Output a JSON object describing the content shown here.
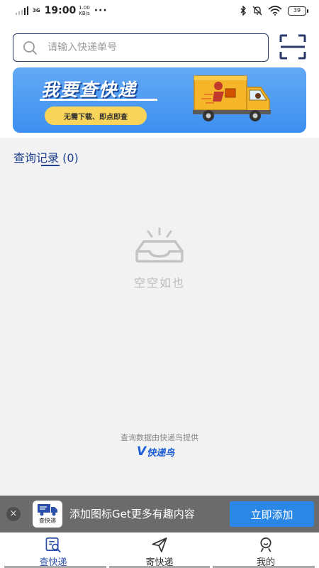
{
  "status_bar": {
    "network": "3G",
    "time": "19:00",
    "speed_value": "1.00",
    "speed_unit": "KB/s",
    "more": "···",
    "battery": "39"
  },
  "search": {
    "placeholder": "请输入快递单号",
    "icon": "search-icon",
    "scan_icon": "scan-icon"
  },
  "banner": {
    "title": "我要查快递",
    "pill": "无需下载、即点即查",
    "colors": {
      "background": "#4a9af2",
      "pill": "#f9d45a",
      "truck": "#f5b62a"
    }
  },
  "history": {
    "title": "查询记录 (0)",
    "empty_text": "空空如也"
  },
  "provider": {
    "text": "查询数据由快递鸟提供",
    "logo_v": "V",
    "logo_name": "快递鸟"
  },
  "promo": {
    "close": "×",
    "app_label": "查快递",
    "text": "添加图标Get更多有趣内容",
    "button": "立即添加"
  },
  "tabs": [
    {
      "label": "查快递",
      "icon": "search-doc-icon",
      "active": true
    },
    {
      "label": "寄快递",
      "icon": "send-icon",
      "active": false
    },
    {
      "label": "我的",
      "icon": "user-icon",
      "active": false
    }
  ],
  "colors": {
    "accent": "#2b4fa8",
    "promo_button": "#2b87e6"
  }
}
